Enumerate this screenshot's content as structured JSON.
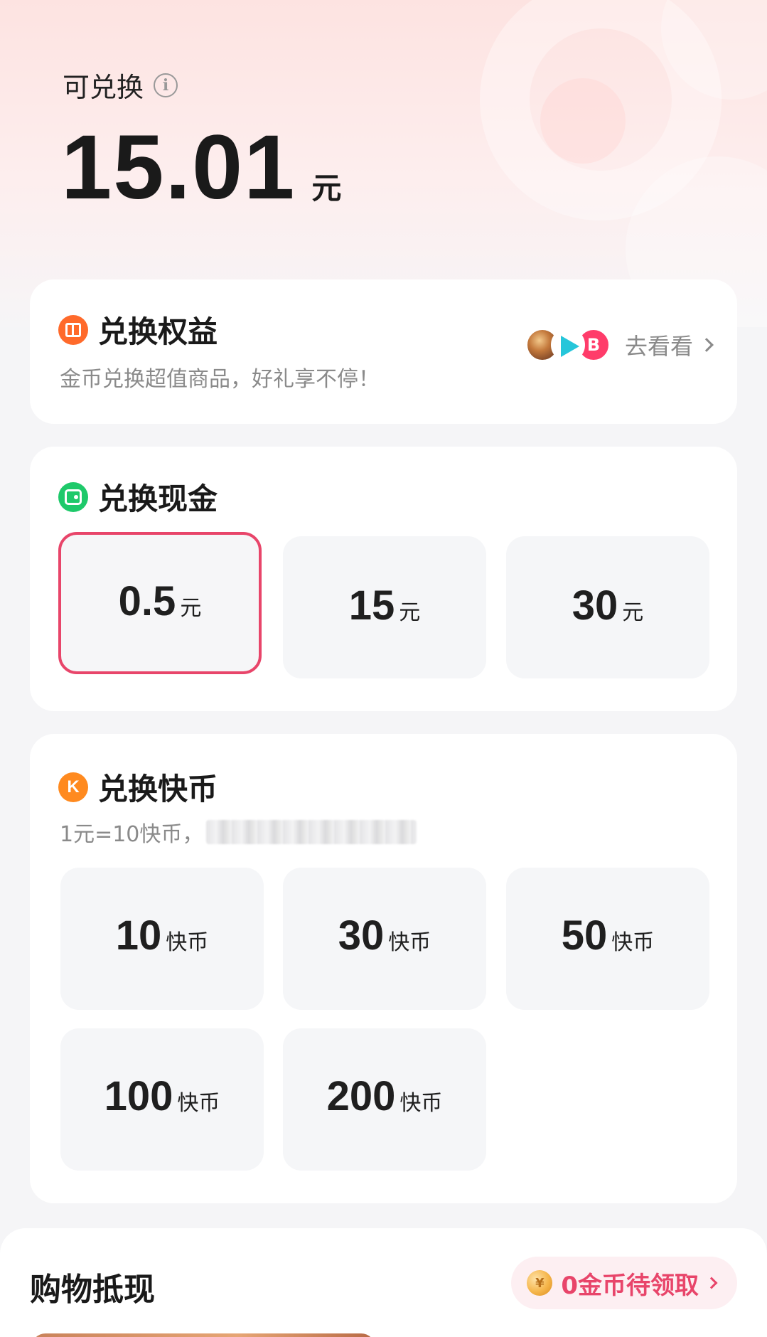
{
  "balance": {
    "label": "可兑换",
    "info_icon": "info-icon",
    "amount": "15.01",
    "unit": "元"
  },
  "rights": {
    "title": "兑换权益",
    "subtitle": "金币兑换超值商品，好礼享不停！",
    "go_label": "去看看",
    "icon": "gift-icon"
  },
  "cash": {
    "title": "兑换现金",
    "icon": "wallet-icon",
    "options": [
      {
        "value": "0.5",
        "unit": "元",
        "selected": true
      },
      {
        "value": "15",
        "unit": "元",
        "selected": false
      },
      {
        "value": "30",
        "unit": "元",
        "selected": false
      }
    ]
  },
  "kuaibi": {
    "title": "兑换快币",
    "badge": "K",
    "subtitle": "1元=10快币，",
    "options": [
      {
        "value": "10",
        "unit": "快币"
      },
      {
        "value": "30",
        "unit": "快币"
      },
      {
        "value": "50",
        "unit": "快币"
      },
      {
        "value": "100",
        "unit": "快币"
      },
      {
        "value": "200",
        "unit": "快币"
      }
    ]
  },
  "shopping": {
    "title": "购物抵现",
    "pill_label": "0金币待领取"
  },
  "colors": {
    "accent": "#e8456a",
    "selected_border": "#e8456a",
    "option_bg": "#f5f6f8"
  }
}
